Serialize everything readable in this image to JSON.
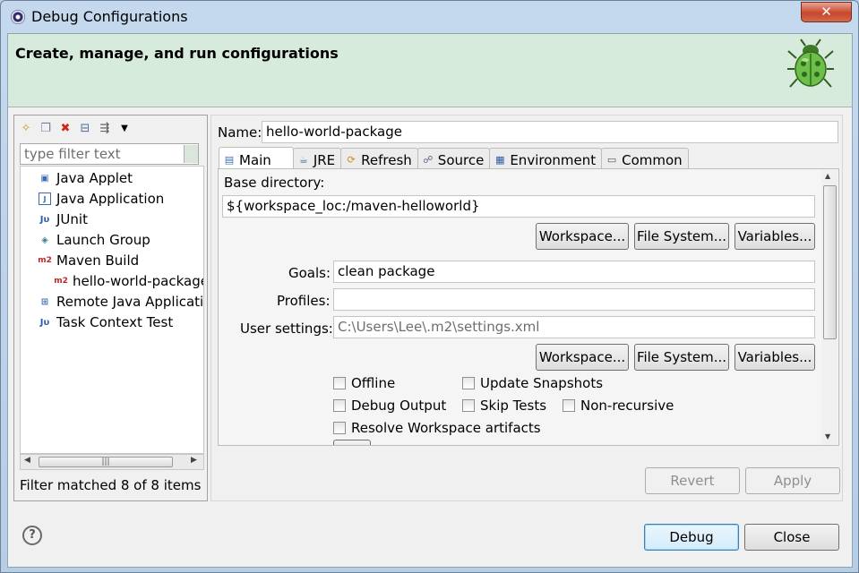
{
  "window": {
    "title": "Debug Configurations",
    "close_label": "✕"
  },
  "header": {
    "title": "Create, manage, and run configurations"
  },
  "left": {
    "filter_placeholder": "type filter text",
    "tree": [
      {
        "label": "Java Applet",
        "icon": "java-applet-icon"
      },
      {
        "label": "Java Application",
        "icon": "java-application-icon"
      },
      {
        "label": "JUnit",
        "icon": "junit-icon"
      },
      {
        "label": "Launch Group",
        "icon": "launch-group-icon"
      },
      {
        "label": "Maven Build",
        "icon": "maven-icon"
      },
      {
        "label": "hello-world-package",
        "icon": "maven-config-icon"
      },
      {
        "label": "Remote Java Application",
        "icon": "remote-java-icon"
      },
      {
        "label": "Task Context Test",
        "icon": "task-context-icon"
      }
    ],
    "status": "Filter matched 8 of 8 items"
  },
  "config": {
    "name_label": "Name:",
    "name_value": "hello-world-package",
    "tabs": [
      "Main",
      "JRE",
      "Refresh",
      "Source",
      "Environment",
      "Common"
    ],
    "base_dir_label": "Base directory:",
    "base_dir_value": "${workspace_loc:/maven-helloworld}",
    "workspace_btn": "Workspace...",
    "filesystem_btn": "File System...",
    "variables_btn": "Variables...",
    "goals_label": "Goals:",
    "goals_value": "clean package",
    "profiles_label": "Profiles:",
    "profiles_value": "",
    "user_settings_label": "User settings:",
    "user_settings_value": "C:\\Users\\Lee\\.m2\\settings.xml",
    "checkboxes": {
      "offline": "Offline",
      "update_snapshots": "Update Snapshots",
      "debug_output": "Debug Output",
      "skip_tests": "Skip Tests",
      "non_recursive": "Non-recursive",
      "resolve_workspace": "Resolve Workspace artifacts"
    },
    "revert": "Revert",
    "apply": "Apply"
  },
  "footer": {
    "help": "?",
    "debug": "Debug",
    "close": "Close"
  }
}
